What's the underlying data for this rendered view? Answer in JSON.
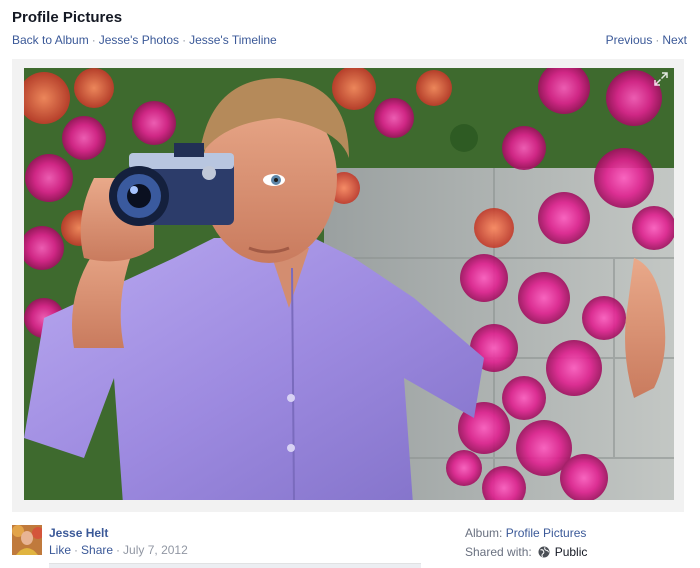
{
  "header": {
    "title": "Profile Pictures",
    "breadcrumbs": [
      "Back to Album",
      "Jesse's Photos",
      "Jesse's Timeline"
    ],
    "separator": "·",
    "pager": {
      "previous": "Previous",
      "next": "Next"
    }
  },
  "photo": {
    "subject": "man in lavender shirt holding a camera in front of pink bougainvillea flowers",
    "expand_icon": "expand-icon"
  },
  "footer": {
    "author": "Jesse Helt",
    "like": "Like",
    "share": "Share",
    "date": "July 7, 2012",
    "album_label": "Album:",
    "album_name": "Profile Pictures",
    "shared_label": "Shared with:",
    "shared_icon": "globe-icon",
    "shared_value": "Public"
  },
  "colors": {
    "link": "#3b5998",
    "muted": "#9197a3",
    "text": "#141823"
  }
}
